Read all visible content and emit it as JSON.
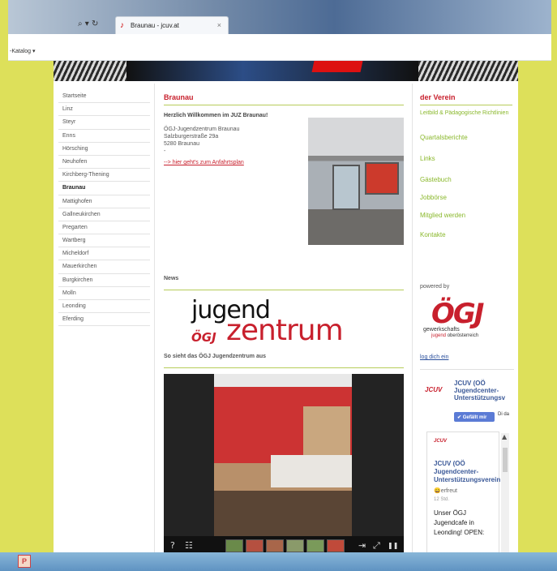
{
  "browser": {
    "tab_title": "Braunau - jcuv.at",
    "address_tools": "⌕ ▾ ↻",
    "bookmark": "-Katalog ▾",
    "close": "×"
  },
  "left_nav": {
    "items": [
      "Startseite",
      "Linz",
      "Steyr",
      "Enns",
      "Hörsching",
      "Neuhofen",
      "Kirchberg-Thening",
      "Braunau",
      "Mattighofen",
      "Gallneukirchen",
      "Pregarten",
      "Wartberg",
      "Micheldorf",
      "Mauerkirchen",
      "Burgkirchen",
      "Molln",
      "Leonding",
      "Eferding"
    ],
    "active": "Braunau"
  },
  "main": {
    "heading": "Braunau",
    "welcome": "Herzlich Willkommen im JUZ Braunau!",
    "address_line1": "ÖGJ-Jugendzentrum Braunau",
    "address_line2": "Salzburgerstraße 29a",
    "address_line3": "5280 Braunau",
    "address_line4": "-",
    "directions_link": "--> hier geht's zum Anfahrtsplan",
    "news_heading": "News",
    "logo_word1": "jugend",
    "logo_word2": "zentrum",
    "logo_brand": "ÖGJ",
    "caption": "So sieht das ÖGJ Jugendzentrum aus"
  },
  "gallery": {
    "help_icon": "?",
    "grid_icon": "☷",
    "thumb_colors": [
      "#6a8a4a",
      "#b55040",
      "#a8664a",
      "#8a9a6a",
      "#7a9a5a",
      "#c04a3a"
    ],
    "share_icon": "⇥",
    "fullscreen_icon": "⤢",
    "pause_icon": "❚❚"
  },
  "right": {
    "heading": "der Verein",
    "links": [
      "Leitbild & Pädagogische Richtlinien",
      "Quartalsberichte",
      "Links",
      "Gästebuch",
      "Jobbörse",
      "Mitglied werden",
      "Kontakte"
    ],
    "powered_by": "powered by",
    "ogj_logo": "ÖGJ",
    "ogj_sub1": "gewerkschafts",
    "ogj_sub2a": "jugend",
    "ogj_sub2b": "oberösterreich",
    "login": "log dich ein"
  },
  "facebook": {
    "page_logo": "JCUV",
    "page_name": "JCUV (OÖ Jugendcenter-Unterstützungsv",
    "like_button": "✔ Gefällt mir",
    "like_text": "Di da",
    "post_logo": "JCUV",
    "post_name": "JCUV (OÖ Jugendcenter-Unterstützungsverein",
    "feeling": "😄erfreut",
    "time": "12 Std.",
    "message": "Unser ÖGJ Jugendcafe in Leonding! OPEN:",
    "scroll_up": "▲"
  },
  "taskbar": {
    "app_label": "P"
  },
  "colors": {
    "accent_red": "#c8202d",
    "link_green": "#8ab82c",
    "line_green": "#b7cc5a",
    "page_bg": "#dde05a"
  }
}
